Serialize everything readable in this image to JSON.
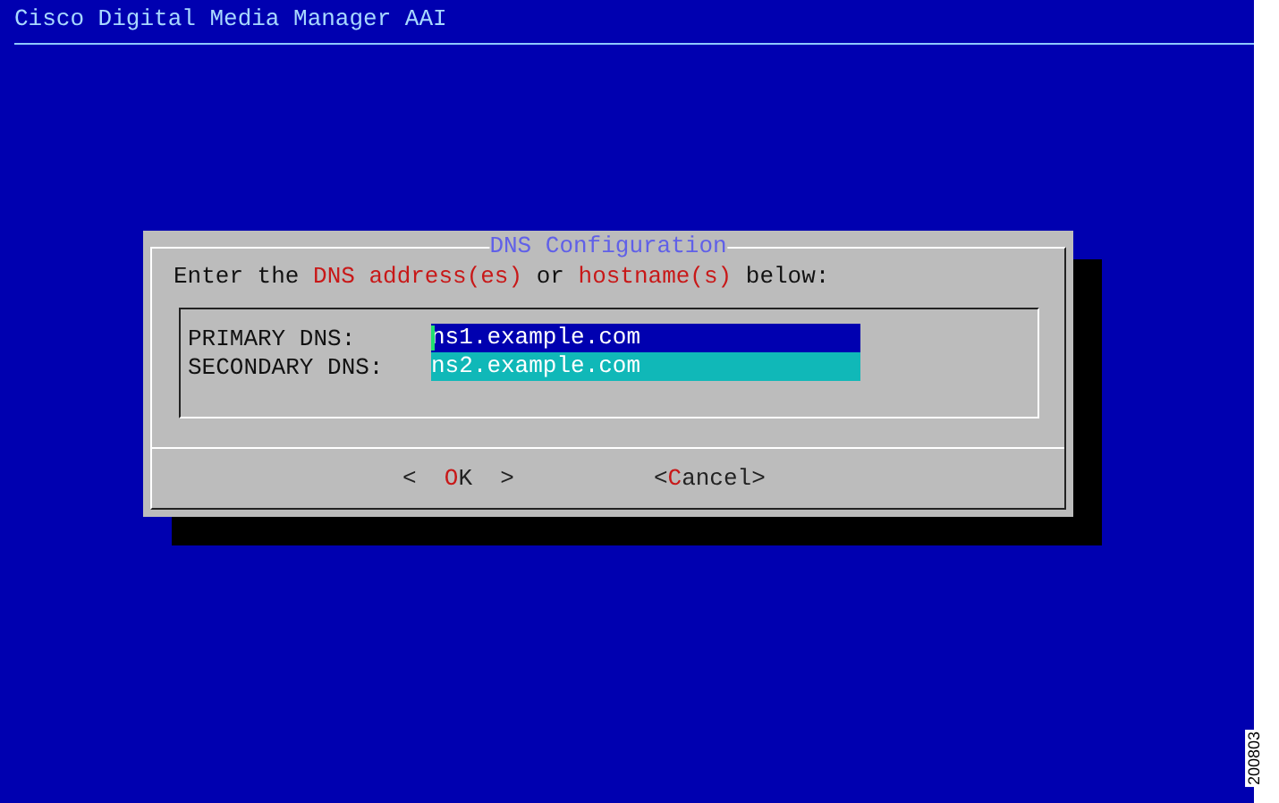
{
  "header": {
    "title": "Cisco Digital Media Manager AAI"
  },
  "dialog": {
    "title": "DNS Configuration",
    "prompt": [
      {
        "text": "Enter the ",
        "highlight": false
      },
      {
        "text": "DNS address(es)",
        "highlight": true
      },
      {
        "text": " or ",
        "highlight": false
      },
      {
        "text": "hostname(s)",
        "highlight": true
      },
      {
        "text": " below:",
        "highlight": false
      }
    ],
    "fields": [
      {
        "label": "PRIMARY DNS:",
        "value": "ns1.example.com",
        "selected": true
      },
      {
        "label": "SECONDARY DNS:",
        "value": "ns2.example.com",
        "selected": false
      }
    ],
    "buttons": [
      {
        "open": "<  ",
        "hotkey": "O",
        "rest": "K",
        "close": "  >"
      },
      {
        "open": "<",
        "hotkey": "C",
        "rest": "ancel",
        "close": ">"
      }
    ]
  },
  "figure_number": "200803"
}
